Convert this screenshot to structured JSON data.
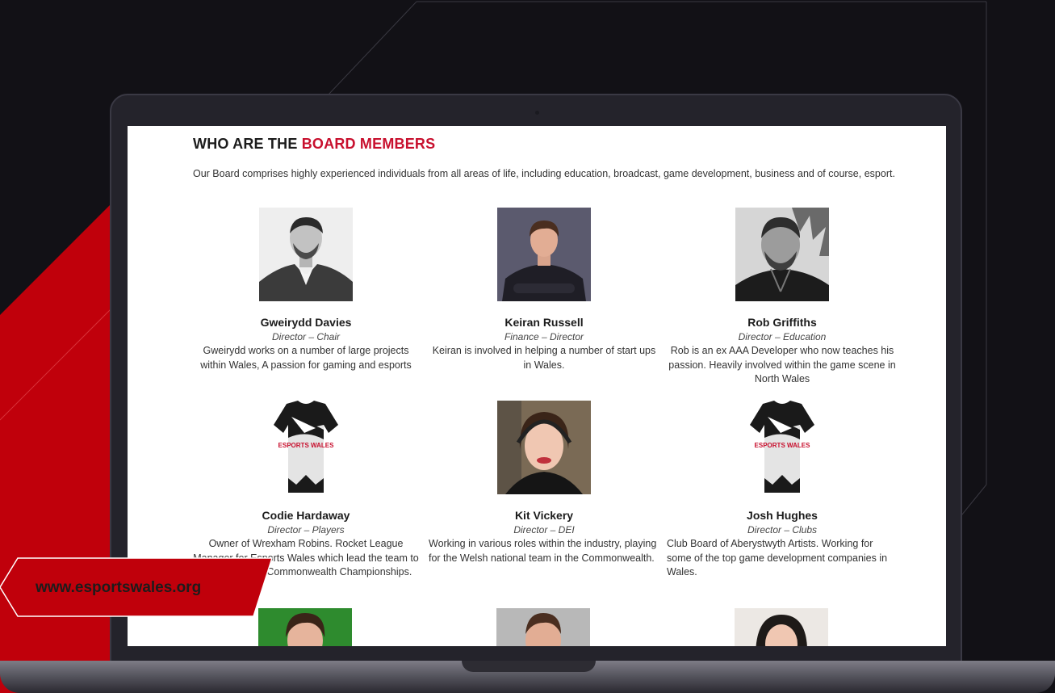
{
  "colors": {
    "accent": "#c8102e",
    "background": "#121116"
  },
  "section": {
    "heading_main": "WHO ARE THE ",
    "heading_accent": "BOARD MEMBERS",
    "intro": "Our Board comprises highly experienced individuals from all areas of life, including education, broadcast, game development, business and of course, esport."
  },
  "members": [
    {
      "name": "Gweirydd Davies",
      "role": "Director – Chair",
      "description": "Gweirydd works on a number of large projects within Wales, A passion for gaming and esports"
    },
    {
      "name": "Keiran Russell",
      "role": "Finance – Director",
      "description": "Keiran is involved in helping a number of start ups in Wales."
    },
    {
      "name": "Rob Griffiths",
      "role": "Director – Education",
      "description": "Rob is an ex AAA Developer who now teaches his passion. Heavily involved within the game scene in North Wales"
    },
    {
      "name": "Codie Hardaway",
      "role": "Director – Players",
      "description": "Owner of Wrexham Robins. Rocket League Manager for Esports Wales which lead the team to a Medal at the Commonwealth Championships."
    },
    {
      "name": "Kit Vickery",
      "role": "Director – DEI",
      "description": "Working in various roles within the industry, playing for the Welsh national team in the Commonwealth."
    },
    {
      "name": "Josh Hughes",
      "role": "Director – Clubs",
      "description": "Club Board of Aberystwyth Artists. Working for some of the top game development companies in Wales."
    }
  ],
  "jersey_text": "ESPORTS WALES",
  "badge": {
    "url": "www.esportswales.org"
  }
}
